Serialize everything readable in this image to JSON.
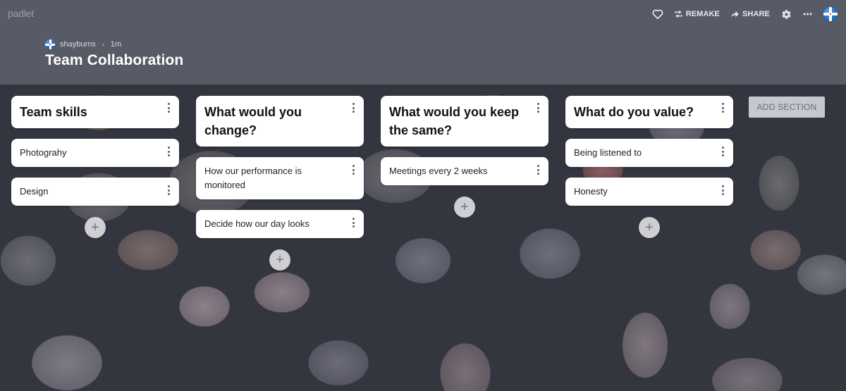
{
  "app": {
    "logo": "padlet"
  },
  "header": {
    "author": "shayburns",
    "time_ago": "1m",
    "title": "Team Collaboration",
    "actions": {
      "like_icon": "heart-icon",
      "remake_label": "REMAKE",
      "share_label": "SHARE",
      "settings_icon": "gear-icon",
      "more_icon": "more-horizontal-icon",
      "avatar_icon": "flag-avatar-icon"
    }
  },
  "sections": [
    {
      "title": "Team skills",
      "posts": [
        "Photograhy",
        "Design"
      ]
    },
    {
      "title": "What would you change?",
      "posts": [
        "How our performance is monitored",
        "Decide how our day looks"
      ]
    },
    {
      "title": "What would you keep the same?",
      "posts": [
        "Meetings every 2 weeks"
      ]
    },
    {
      "title": "What do you value?",
      "posts": [
        "Being listened to",
        "Honesty"
      ]
    }
  ],
  "add_post_symbol": "+",
  "add_section_label": "ADD SECTION",
  "colors": {
    "header_bg": "#575b66",
    "card_bg": "#ffffff",
    "title_text": "#ffffff"
  }
}
